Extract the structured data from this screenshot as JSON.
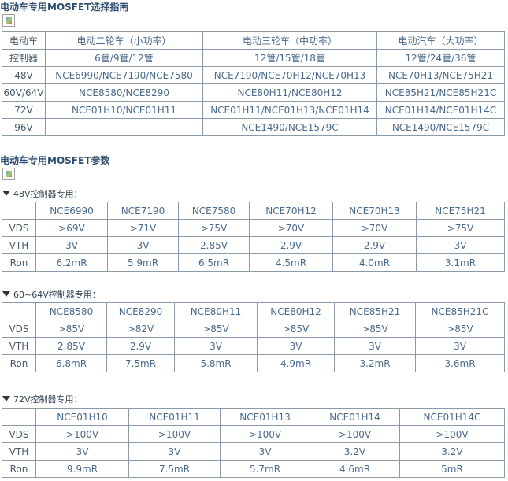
{
  "selection_title": "电动车专用MOSFET选择指南",
  "params_title": "电动车专用MOSFET参数",
  "selection": {
    "header": [
      "电动车",
      "电动二轮车（小功率）",
      "电动三轮车（中功率）",
      "电动汽车（大功率）"
    ],
    "rows": [
      [
        "控制器",
        "6管/9管/12管",
        "12管/15管/18管",
        "12管/24管/36管"
      ],
      [
        "48V",
        "NCE6990/NCE7190/NCE7580",
        "NCE7190/NCE70H12/NCE70H13",
        "NCE70H13/NCE75H21"
      ],
      [
        "60V/64V",
        "NCE8580/NCE8290",
        "NCE80H11/NCE80H12",
        "NCE85H21/NCE85H21C"
      ],
      [
        "72V",
        "NCE01H10/NCE01H11",
        "NCE01H11/NCE01H13/NCE01H14",
        "NCE01H14/NCE01H14C"
      ],
      [
        "96V",
        "-",
        "NCE1490/NCE1579C",
        "NCE1490/NCE1579C"
      ]
    ]
  },
  "groups": [
    {
      "label": "48V控制器专用：",
      "parts": [
        "NCE6990",
        "NCE7190",
        "NCE7580",
        "NCE70H12",
        "NCE70H13",
        "NCE75H21"
      ],
      "rows": [
        {
          "param": "VDS",
          "values": [
            ">69V",
            ">71V",
            ">75V",
            ">70V",
            ">70V",
            ">75V"
          ]
        },
        {
          "param": "VTH",
          "values": [
            "3V",
            "3V",
            "2.85V",
            "2.9V",
            "2.9V",
            "3V"
          ]
        },
        {
          "param": "Ron",
          "values": [
            "6.2mR",
            "5.9mR",
            "6.5mR",
            "4.5mR",
            "4.0mR",
            "3.1mR"
          ]
        }
      ]
    },
    {
      "label": "60~64V控制器专用：",
      "parts": [
        "NCE8580",
        "NCE8290",
        "NCE80H11",
        "NCE80H12",
        "NCE85H21",
        "NCE85H21C"
      ],
      "rows": [
        {
          "param": "VDS",
          "values": [
            ">85V",
            ">82V",
            ">85V",
            ">85V",
            ">85V",
            ">85V"
          ]
        },
        {
          "param": "VTH",
          "values": [
            "2.85V",
            "2.9V",
            "3V",
            "3V",
            "3V",
            "3V"
          ]
        },
        {
          "param": "Ron",
          "values": [
            "6.8mR",
            "7.5mR",
            "5.8mR",
            "4.9mR",
            "3.2mR",
            "3.6mR"
          ]
        }
      ]
    },
    {
      "label": "72V控制器专用：",
      "parts": [
        "NCE01H10",
        "NCE01H11",
        "NCE01H13",
        "NCE01H14",
        "NCE01H14C"
      ],
      "rows": [
        {
          "param": "VDS",
          "values": [
            ">100V",
            ">100V",
            ">100V",
            ">100V",
            ">100V"
          ]
        },
        {
          "param": "VTH",
          "values": [
            "3V",
            "3V",
            "3V",
            "3.2V",
            "3.2V"
          ]
        },
        {
          "param": "Ron",
          "values": [
            "9.9mR",
            "7.5mR",
            "5.7mR",
            "4.6mR",
            "5mR"
          ]
        }
      ]
    }
  ]
}
